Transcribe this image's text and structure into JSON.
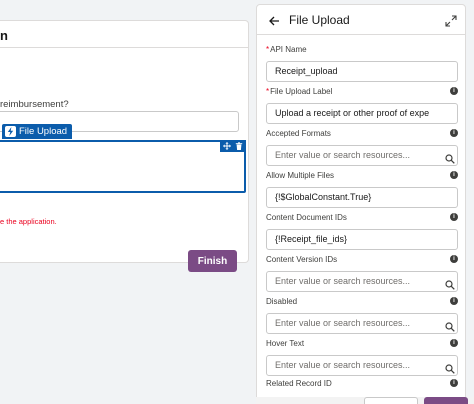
{
  "canvas": {
    "header_title": "n",
    "question_label": "reimbursement?",
    "component_tag": "File Upload",
    "error_text": "e the application.",
    "finish_label": "Finish"
  },
  "panel": {
    "title": "File Upload",
    "fields": [
      {
        "label": "API Name",
        "required": true,
        "value": "Receipt_upload",
        "placeholder": false,
        "info": false,
        "search": false
      },
      {
        "label": "File Upload Label",
        "required": true,
        "value": "Upload a receipt or other proof of expe",
        "placeholder": false,
        "info": true,
        "search": false
      },
      {
        "label": "Accepted Formats",
        "required": false,
        "value": "Enter value or search resources...",
        "placeholder": true,
        "info": true,
        "search": true
      },
      {
        "label": "Allow Multiple Files",
        "required": false,
        "value": "{!$GlobalConstant.True}",
        "placeholder": false,
        "info": true,
        "search": false
      },
      {
        "label": "Content Document IDs",
        "required": false,
        "value": "{!Receipt_file_ids}",
        "placeholder": false,
        "info": true,
        "search": false
      },
      {
        "label": "Content Version IDs",
        "required": false,
        "value": "Enter value or search resources...",
        "placeholder": true,
        "info": true,
        "search": true
      },
      {
        "label": "Disabled",
        "required": false,
        "value": "Enter value or search resources...",
        "placeholder": true,
        "info": true,
        "search": true
      },
      {
        "label": "Hover Text",
        "required": false,
        "value": "Enter value or search resources...",
        "placeholder": true,
        "info": true,
        "search": true
      },
      {
        "label": "Related Record ID",
        "required": false,
        "value": "",
        "placeholder": false,
        "info": true,
        "search": false
      }
    ]
  },
  "colors": {
    "brand_blue": "#0b5cab",
    "finish_purple": "#7b4b85",
    "error_red": "#ea001e"
  },
  "icons": {
    "back": "arrow-left-icon",
    "expand": "expand-icon",
    "info": "info-icon",
    "search": "search-icon",
    "bolt": "lightning-bolt-icon",
    "move": "move-icon",
    "delete": "trash-icon"
  }
}
